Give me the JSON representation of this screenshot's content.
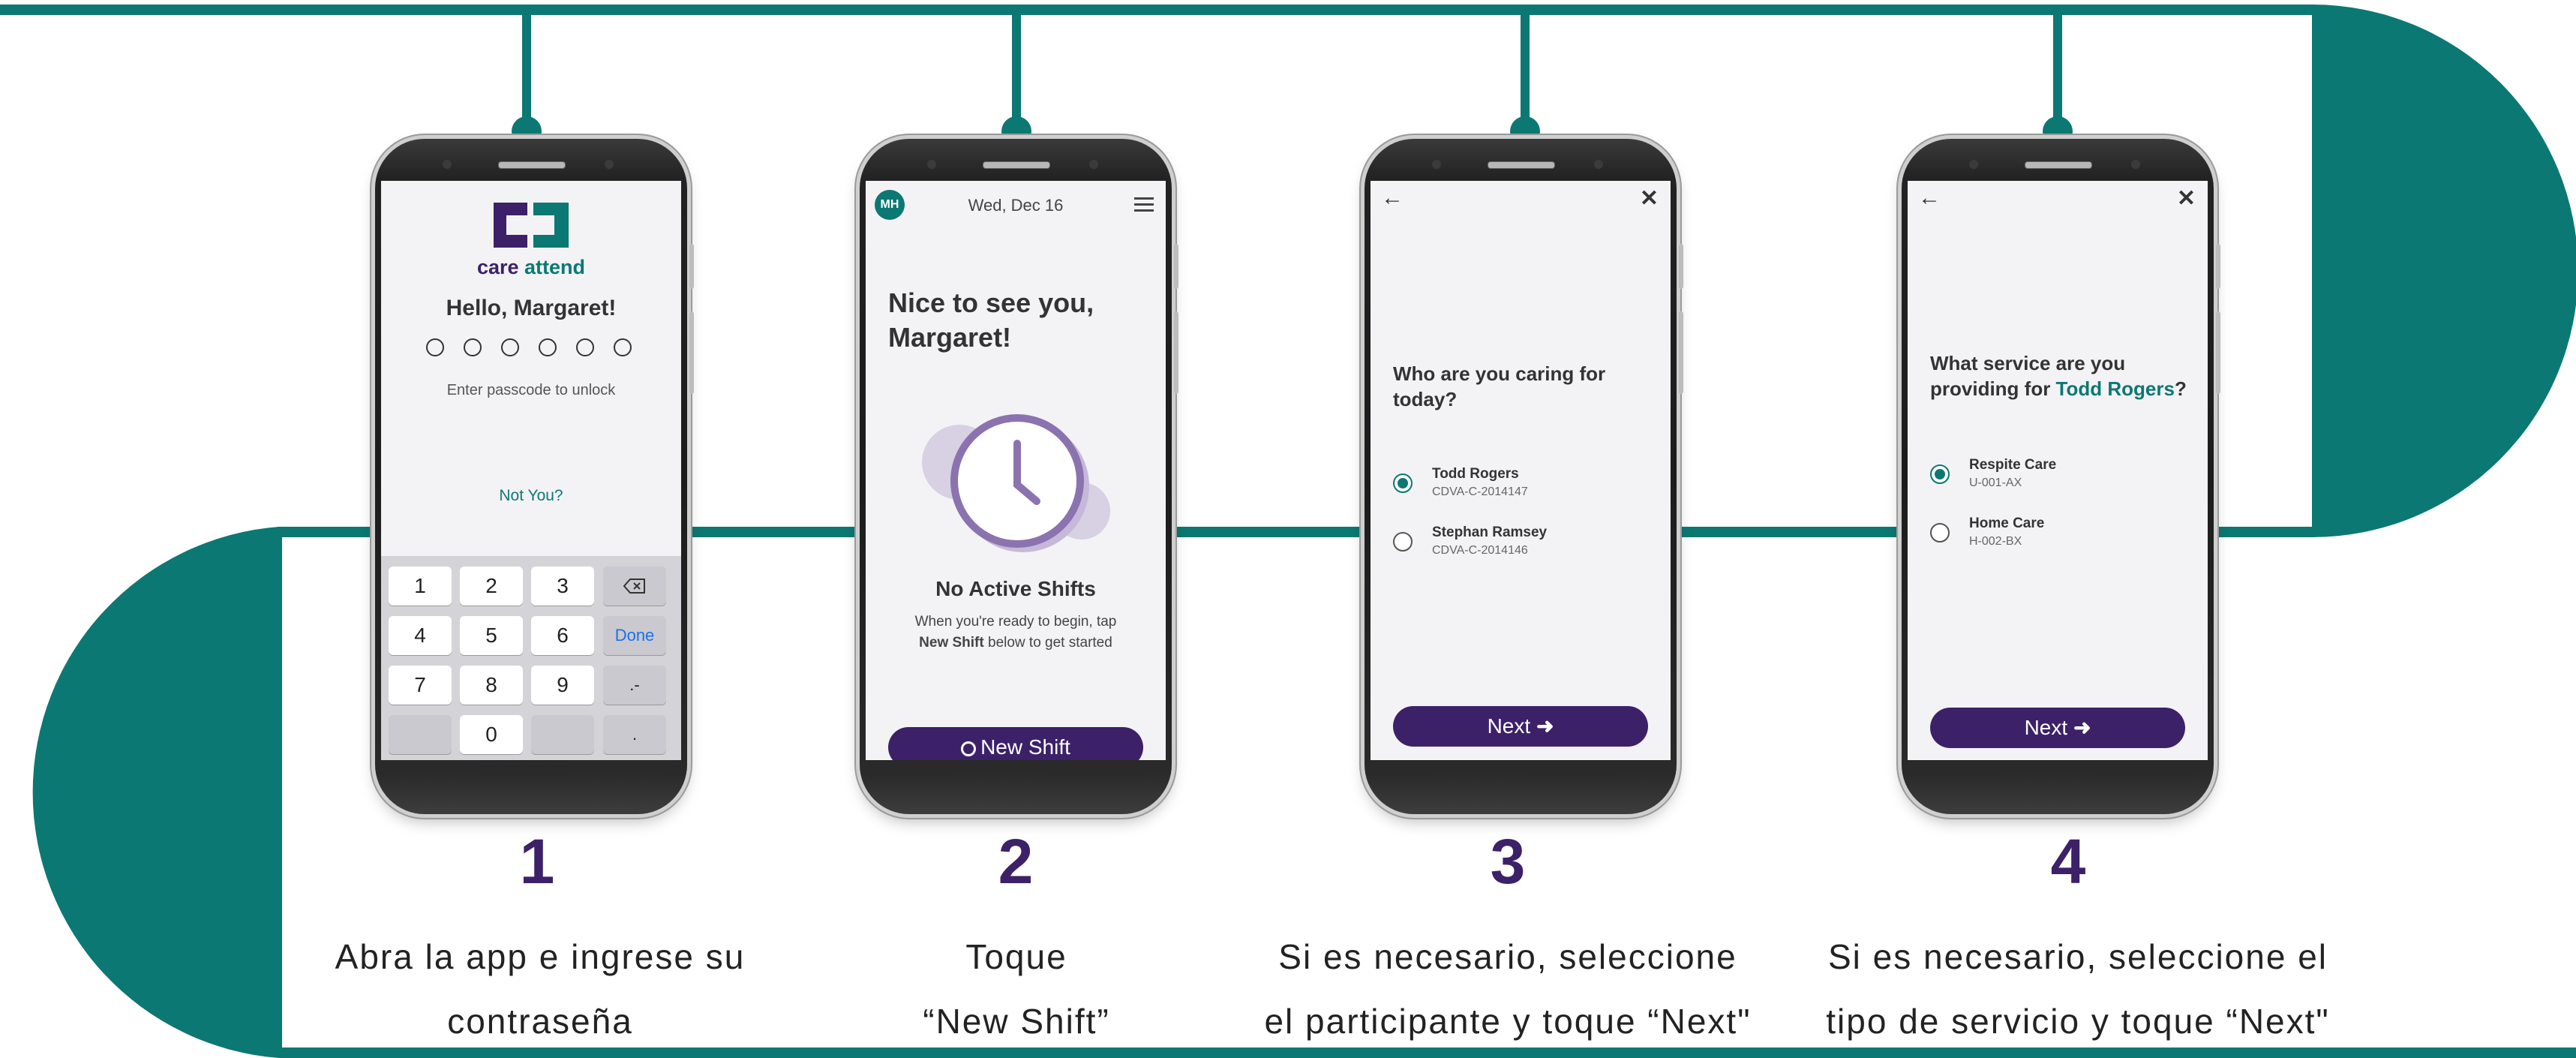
{
  "colors": {
    "teal": "#0c7873",
    "purple": "#3c2168",
    "screen_bg": "#f3f3f6"
  },
  "steps": [
    {
      "number": "1",
      "caption_line1": "Abra la app e ingrese su",
      "caption_line2": "contraseña",
      "screen": {
        "logo_word1": "care",
        "logo_word2": "attend",
        "greeting": "Hello, Margaret!",
        "passcode_hint": "Enter passcode to unlock",
        "not_you": "Not You?",
        "keys": [
          "1",
          "2",
          "3",
          "4",
          "5",
          "6",
          "7",
          "8",
          "9",
          "0"
        ],
        "done_key": "Done",
        "symbol_key": ".-",
        "period_key": "."
      }
    },
    {
      "number": "2",
      "caption_line1": "Toque",
      "caption_line2": "“New Shift”",
      "screen": {
        "avatar": "MH",
        "date": "Wed, Dec 16",
        "welcome_line1": "Nice to see you,",
        "welcome_line2": "Margaret!",
        "no_shifts": "No Active Shifts",
        "help_line1": "When you're ready to begin, tap",
        "help_bold": "New Shift",
        "help_line2": " below to get started",
        "button": "New Shift"
      }
    },
    {
      "number": "3",
      "caption_line1": "Si es necesario, seleccione",
      "caption_line2": "el participante y toque “Next\"",
      "screen": {
        "question_line1": "Who are you caring for",
        "question_line2": "today?",
        "options": [
          {
            "name": "Todd Rogers",
            "code": "CDVA-C-2014147",
            "selected": true
          },
          {
            "name": "Stephan Ramsey",
            "code": "CDVA-C-2014146",
            "selected": false
          }
        ],
        "next": "Next"
      }
    },
    {
      "number": "4",
      "caption_line1": "Si es necesario, seleccione el",
      "caption_line2": "tipo de servicio y toque “Next\"",
      "screen": {
        "question_line1": "What service are you",
        "question_line2_prefix": "providing for ",
        "question_name": "Todd Rogers",
        "question_suffix": "?",
        "options": [
          {
            "name": "Respite Care",
            "code": "U-001-AX",
            "selected": true
          },
          {
            "name": "Home Care",
            "code": "H-002-BX",
            "selected": false
          }
        ],
        "next": "Next"
      }
    }
  ]
}
